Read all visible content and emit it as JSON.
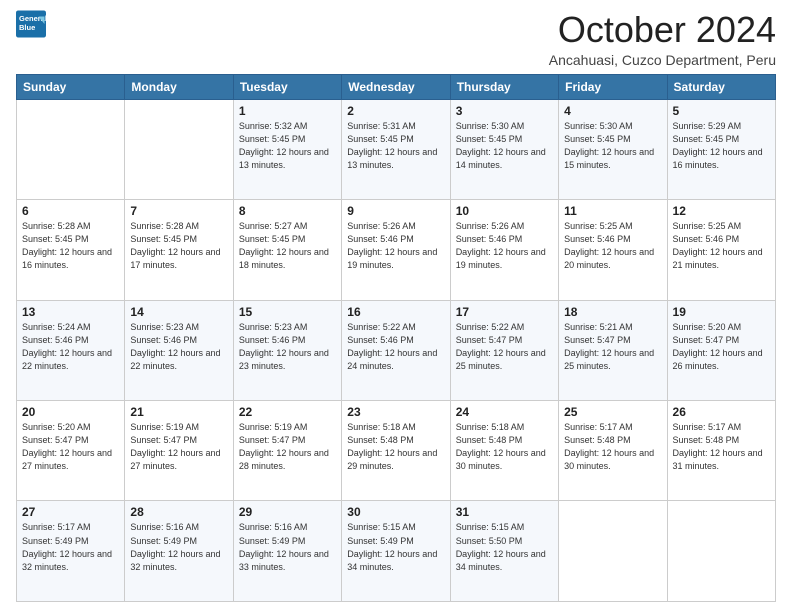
{
  "logo": {
    "line1": "General",
    "line2": "Blue"
  },
  "title": "October 2024",
  "subtitle": "Ancahuasi, Cuzco Department, Peru",
  "days_of_week": [
    "Sunday",
    "Monday",
    "Tuesday",
    "Wednesday",
    "Thursday",
    "Friday",
    "Saturday"
  ],
  "weeks": [
    [
      {
        "day": "",
        "sunrise": "",
        "sunset": "",
        "daylight": ""
      },
      {
        "day": "",
        "sunrise": "",
        "sunset": "",
        "daylight": ""
      },
      {
        "day": "1",
        "sunrise": "Sunrise: 5:32 AM",
        "sunset": "Sunset: 5:45 PM",
        "daylight": "Daylight: 12 hours and 13 minutes."
      },
      {
        "day": "2",
        "sunrise": "Sunrise: 5:31 AM",
        "sunset": "Sunset: 5:45 PM",
        "daylight": "Daylight: 12 hours and 13 minutes."
      },
      {
        "day": "3",
        "sunrise": "Sunrise: 5:30 AM",
        "sunset": "Sunset: 5:45 PM",
        "daylight": "Daylight: 12 hours and 14 minutes."
      },
      {
        "day": "4",
        "sunrise": "Sunrise: 5:30 AM",
        "sunset": "Sunset: 5:45 PM",
        "daylight": "Daylight: 12 hours and 15 minutes."
      },
      {
        "day": "5",
        "sunrise": "Sunrise: 5:29 AM",
        "sunset": "Sunset: 5:45 PM",
        "daylight": "Daylight: 12 hours and 16 minutes."
      }
    ],
    [
      {
        "day": "6",
        "sunrise": "Sunrise: 5:28 AM",
        "sunset": "Sunset: 5:45 PM",
        "daylight": "Daylight: 12 hours and 16 minutes."
      },
      {
        "day": "7",
        "sunrise": "Sunrise: 5:28 AM",
        "sunset": "Sunset: 5:45 PM",
        "daylight": "Daylight: 12 hours and 17 minutes."
      },
      {
        "day": "8",
        "sunrise": "Sunrise: 5:27 AM",
        "sunset": "Sunset: 5:45 PM",
        "daylight": "Daylight: 12 hours and 18 minutes."
      },
      {
        "day": "9",
        "sunrise": "Sunrise: 5:26 AM",
        "sunset": "Sunset: 5:46 PM",
        "daylight": "Daylight: 12 hours and 19 minutes."
      },
      {
        "day": "10",
        "sunrise": "Sunrise: 5:26 AM",
        "sunset": "Sunset: 5:46 PM",
        "daylight": "Daylight: 12 hours and 19 minutes."
      },
      {
        "day": "11",
        "sunrise": "Sunrise: 5:25 AM",
        "sunset": "Sunset: 5:46 PM",
        "daylight": "Daylight: 12 hours and 20 minutes."
      },
      {
        "day": "12",
        "sunrise": "Sunrise: 5:25 AM",
        "sunset": "Sunset: 5:46 PM",
        "daylight": "Daylight: 12 hours and 21 minutes."
      }
    ],
    [
      {
        "day": "13",
        "sunrise": "Sunrise: 5:24 AM",
        "sunset": "Sunset: 5:46 PM",
        "daylight": "Daylight: 12 hours and 22 minutes."
      },
      {
        "day": "14",
        "sunrise": "Sunrise: 5:23 AM",
        "sunset": "Sunset: 5:46 PM",
        "daylight": "Daylight: 12 hours and 22 minutes."
      },
      {
        "day": "15",
        "sunrise": "Sunrise: 5:23 AM",
        "sunset": "Sunset: 5:46 PM",
        "daylight": "Daylight: 12 hours and 23 minutes."
      },
      {
        "day": "16",
        "sunrise": "Sunrise: 5:22 AM",
        "sunset": "Sunset: 5:46 PM",
        "daylight": "Daylight: 12 hours and 24 minutes."
      },
      {
        "day": "17",
        "sunrise": "Sunrise: 5:22 AM",
        "sunset": "Sunset: 5:47 PM",
        "daylight": "Daylight: 12 hours and 25 minutes."
      },
      {
        "day": "18",
        "sunrise": "Sunrise: 5:21 AM",
        "sunset": "Sunset: 5:47 PM",
        "daylight": "Daylight: 12 hours and 25 minutes."
      },
      {
        "day": "19",
        "sunrise": "Sunrise: 5:20 AM",
        "sunset": "Sunset: 5:47 PM",
        "daylight": "Daylight: 12 hours and 26 minutes."
      }
    ],
    [
      {
        "day": "20",
        "sunrise": "Sunrise: 5:20 AM",
        "sunset": "Sunset: 5:47 PM",
        "daylight": "Daylight: 12 hours and 27 minutes."
      },
      {
        "day": "21",
        "sunrise": "Sunrise: 5:19 AM",
        "sunset": "Sunset: 5:47 PM",
        "daylight": "Daylight: 12 hours and 27 minutes."
      },
      {
        "day": "22",
        "sunrise": "Sunrise: 5:19 AM",
        "sunset": "Sunset: 5:47 PM",
        "daylight": "Daylight: 12 hours and 28 minutes."
      },
      {
        "day": "23",
        "sunrise": "Sunrise: 5:18 AM",
        "sunset": "Sunset: 5:48 PM",
        "daylight": "Daylight: 12 hours and 29 minutes."
      },
      {
        "day": "24",
        "sunrise": "Sunrise: 5:18 AM",
        "sunset": "Sunset: 5:48 PM",
        "daylight": "Daylight: 12 hours and 30 minutes."
      },
      {
        "day": "25",
        "sunrise": "Sunrise: 5:17 AM",
        "sunset": "Sunset: 5:48 PM",
        "daylight": "Daylight: 12 hours and 30 minutes."
      },
      {
        "day": "26",
        "sunrise": "Sunrise: 5:17 AM",
        "sunset": "Sunset: 5:48 PM",
        "daylight": "Daylight: 12 hours and 31 minutes."
      }
    ],
    [
      {
        "day": "27",
        "sunrise": "Sunrise: 5:17 AM",
        "sunset": "Sunset: 5:49 PM",
        "daylight": "Daylight: 12 hours and 32 minutes."
      },
      {
        "day": "28",
        "sunrise": "Sunrise: 5:16 AM",
        "sunset": "Sunset: 5:49 PM",
        "daylight": "Daylight: 12 hours and 32 minutes."
      },
      {
        "day": "29",
        "sunrise": "Sunrise: 5:16 AM",
        "sunset": "Sunset: 5:49 PM",
        "daylight": "Daylight: 12 hours and 33 minutes."
      },
      {
        "day": "30",
        "sunrise": "Sunrise: 5:15 AM",
        "sunset": "Sunset: 5:49 PM",
        "daylight": "Daylight: 12 hours and 34 minutes."
      },
      {
        "day": "31",
        "sunrise": "Sunrise: 5:15 AM",
        "sunset": "Sunset: 5:50 PM",
        "daylight": "Daylight: 12 hours and 34 minutes."
      },
      {
        "day": "",
        "sunrise": "",
        "sunset": "",
        "daylight": ""
      },
      {
        "day": "",
        "sunrise": "",
        "sunset": "",
        "daylight": ""
      }
    ]
  ]
}
